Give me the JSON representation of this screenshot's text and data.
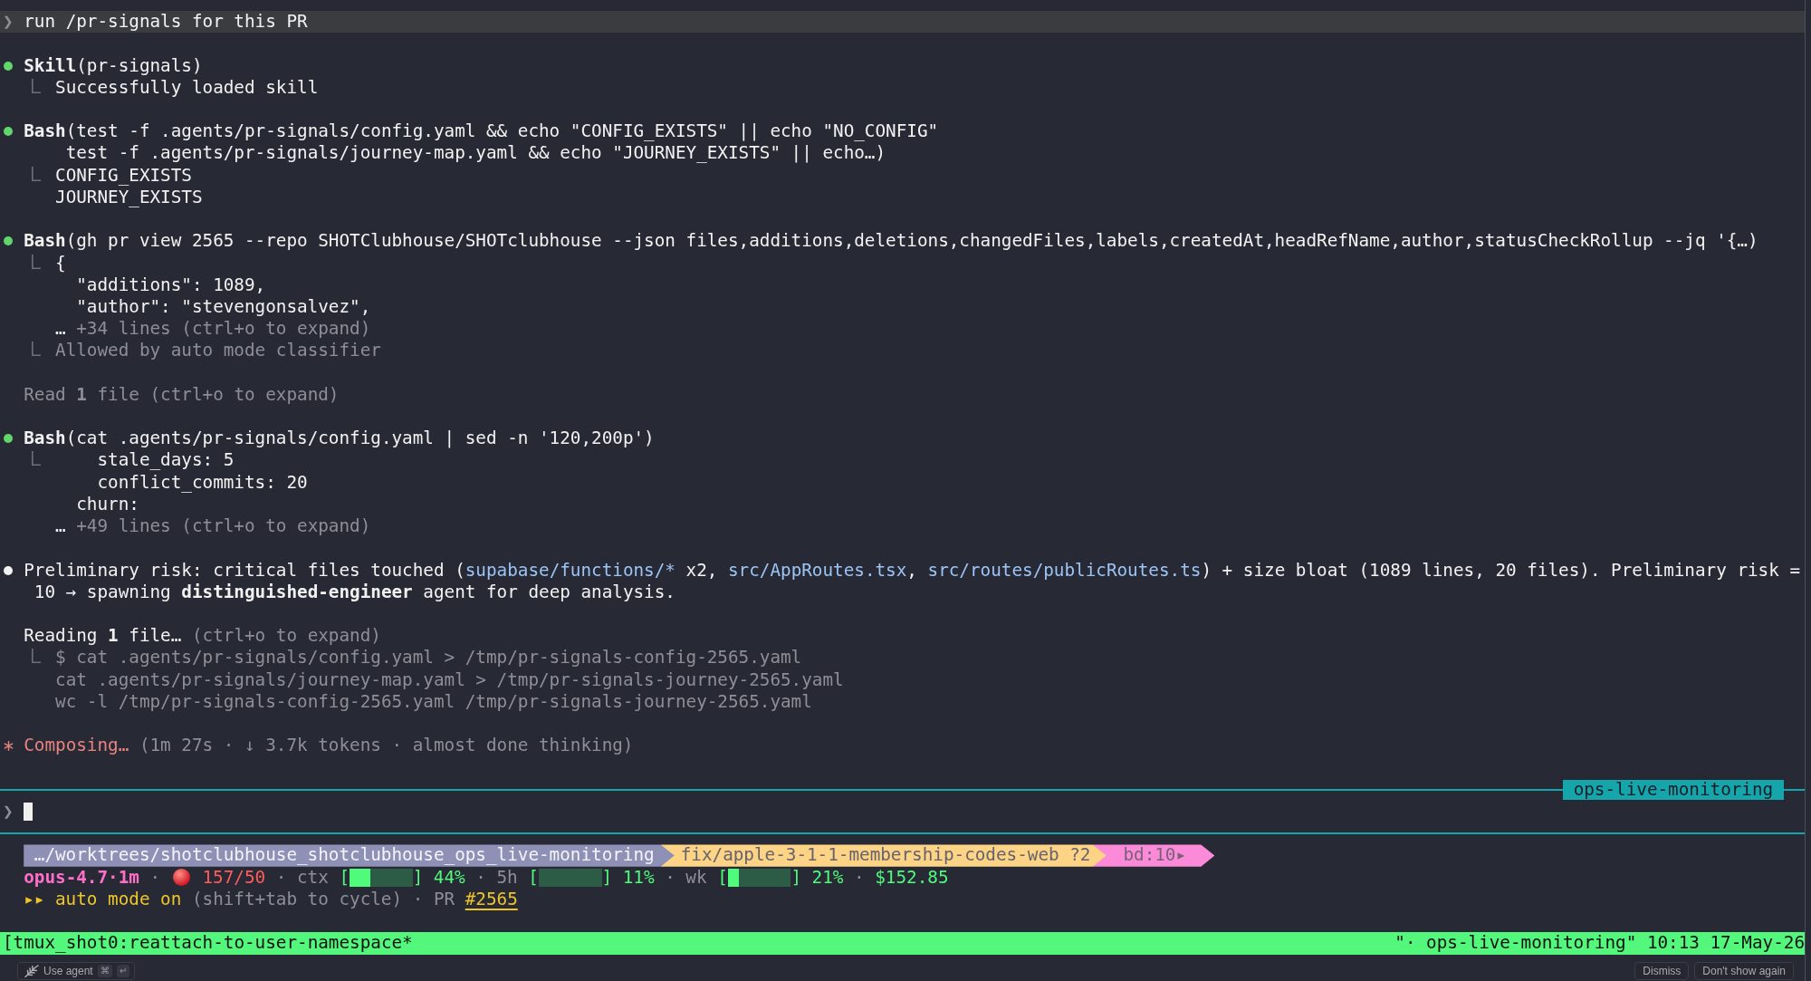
{
  "transcript": [
    {
      "kind": "user",
      "prompt": "❯",
      "text": "run /pr-signals for this PR"
    },
    {
      "kind": "tool",
      "color": "#62d66b",
      "tool": "Skill",
      "command": [
        "(pr-signals)"
      ],
      "results": [
        {
          "dim": false,
          "lines": [
            {
              "text": "Successfully loaded skill"
            }
          ]
        }
      ]
    },
    {
      "kind": "tool",
      "color": "#62d66b",
      "tool": "Bash",
      "command": [
        "(test -f .agents/pr-signals/config.yaml && echo \"CONFIG_EXISTS\" || echo \"NO_CONFIG\"",
        "test -f .agents/pr-signals/journey-map.yaml && echo \"JOURNEY_EXISTS\" || echo…)"
      ],
      "results": [
        {
          "dim": false,
          "lines": [
            {
              "text": "CONFIG_EXISTS"
            },
            {
              "text": "JOURNEY_EXISTS"
            }
          ]
        }
      ]
    },
    {
      "kind": "tool",
      "color": "#62d66b",
      "tool": "Bash",
      "command": [
        "(gh pr view 2565 --repo SHOTClubhouse/SHOTclubhouse --json files,additions,deletions,changedFiles,labels,createdAt,headRefName,author,statusCheckRollup --jq '{…)"
      ],
      "results": [
        {
          "dim": false,
          "lines": [
            {
              "text": "{",
              "children": [
                {
                  "text": "\"additions\": 1089,"
                },
                {
                  "text": "\"author\": \"stevengonsalvez\","
                }
              ]
            },
            {
              "kind": "collapsed",
              "ellipsis": "…",
              "text": "+34 lines (ctrl+o to expand)"
            }
          ]
        },
        {
          "dim": true,
          "lines": [
            {
              "text": "Allowed by auto mode classifier"
            }
          ]
        }
      ]
    },
    {
      "kind": "activity",
      "dim": true,
      "text": "Read **1** file",
      "hint": "(ctrl+o to expand)"
    },
    {
      "kind": "tool",
      "color": "#62d66b",
      "tool": "Bash",
      "command": [
        "(cat .agents/pr-signals/config.yaml | sed -n '120,200p')"
      ],
      "results": [
        {
          "dim": false,
          "lines": [
            {
              "children": [
                {
                  "children": [
                    {
                      "text": "stale_days: 5"
                    },
                    {
                      "text": "conflict_commits: 20"
                    }
                  ]
                },
                {
                  "text": "churn:"
                }
              ]
            },
            {
              "kind": "collapsed",
              "ellipsis": "…",
              "text": "+49 lines (ctrl+o to expand)"
            }
          ]
        }
      ]
    },
    {
      "kind": "message",
      "color": "#f2f2f2",
      "lines": [
        [
          {
            "text": "Preliminary risk: critical files touched ("
          },
          {
            "kind": "link",
            "text": "supabase/functions/*"
          },
          {
            "text": " x2, "
          },
          {
            "kind": "link",
            "text": "src/AppRoutes.tsx"
          },
          {
            "text": ", "
          },
          {
            "kind": "link",
            "text": "src/routes/publicRoutes.ts"
          },
          {
            "text": ") + size bloat (1089 lines, 20 files). Preliminary risk ="
          }
        ],
        [
          {
            "text": "10 → spawning **distinguished-engineer** agent for deep analysis."
          }
        ]
      ]
    },
    {
      "kind": "activity",
      "dim": false,
      "text": "Reading **1** file…",
      "hint": "(ctrl+o to expand)",
      "results": [
        {
          "dim": true,
          "lines": [
            {
              "text": "$ cat .agents/pr-signals/config.yaml > /tmp/pr-signals-config-2565.yaml"
            },
            {
              "text": "cat .agents/pr-signals/journey-map.yaml > /tmp/pr-signals-journey-2565.yaml"
            },
            {
              "text": "wc -l /tmp/pr-signals-config-2565.yaml /tmp/pr-signals-journey-2565.yaml"
            }
          ]
        }
      ]
    },
    {
      "kind": "spinner",
      "text": "Composing…",
      "detail": "(1m 27s · ↓ 3.7k tokens · almost done thinking)"
    }
  ],
  "input": {
    "tag": "ops-live-monitoring",
    "prompt": "❯"
  },
  "statusline": {
    "segments": [
      {
        "kind": "path",
        "color": "#8e90b6",
        "text": "…/worktrees/shotclubhouse_shotclubhouse_ops_live-monitoring"
      },
      {
        "kind": "branch",
        "color": "#fdd386",
        "text": "fix/apple-3-1-1-membership-codes-web ?2"
      },
      {
        "kind": "tag",
        "color": "#fb8ad8",
        "text": "bd:10▸"
      }
    ],
    "metrics": [
      {
        "kind": "model",
        "text": "opus-4.7·1m"
      },
      {
        "kind": "separator",
        "text": "·"
      },
      {
        "kind": "alert",
        "text": "157/50"
      },
      {
        "kind": "separator",
        "text": "·"
      },
      {
        "kind": "meter",
        "label": "ctx",
        "open": "[",
        "level": 0.33,
        "close": "]",
        "reading": "44%"
      },
      {
        "kind": "separator",
        "text": "·"
      },
      {
        "kind": "meter",
        "label": "5h",
        "open": "[",
        "close": "]",
        "reading": "11%"
      },
      {
        "kind": "separator",
        "text": "·"
      },
      {
        "kind": "meter",
        "label": "wk",
        "open": "[",
        "level": 0.17,
        "close": "]",
        "reading": "21%"
      },
      {
        "kind": "separator",
        "text": "·"
      },
      {
        "kind": "cost",
        "text": "$152.85"
      }
    ],
    "mode": {
      "indicator": "▸▸",
      "text": "auto mode on",
      "hint": "(shift+tab to cycle)",
      "separator": "·",
      "pr_label": "PR",
      "pr_link": "#2565"
    }
  },
  "tmux": {
    "session": "[tmux_shot0:reattach-to-user-namespace*",
    "title": "\"· ops-live-monitoring\"",
    "time": "10:13",
    "date": "17-May-26"
  },
  "hint_bar": {
    "action": "Use agent",
    "keys": [
      "⌘",
      "↵"
    ],
    "buttons": [
      "Dismiss",
      "Don't show again"
    ]
  }
}
